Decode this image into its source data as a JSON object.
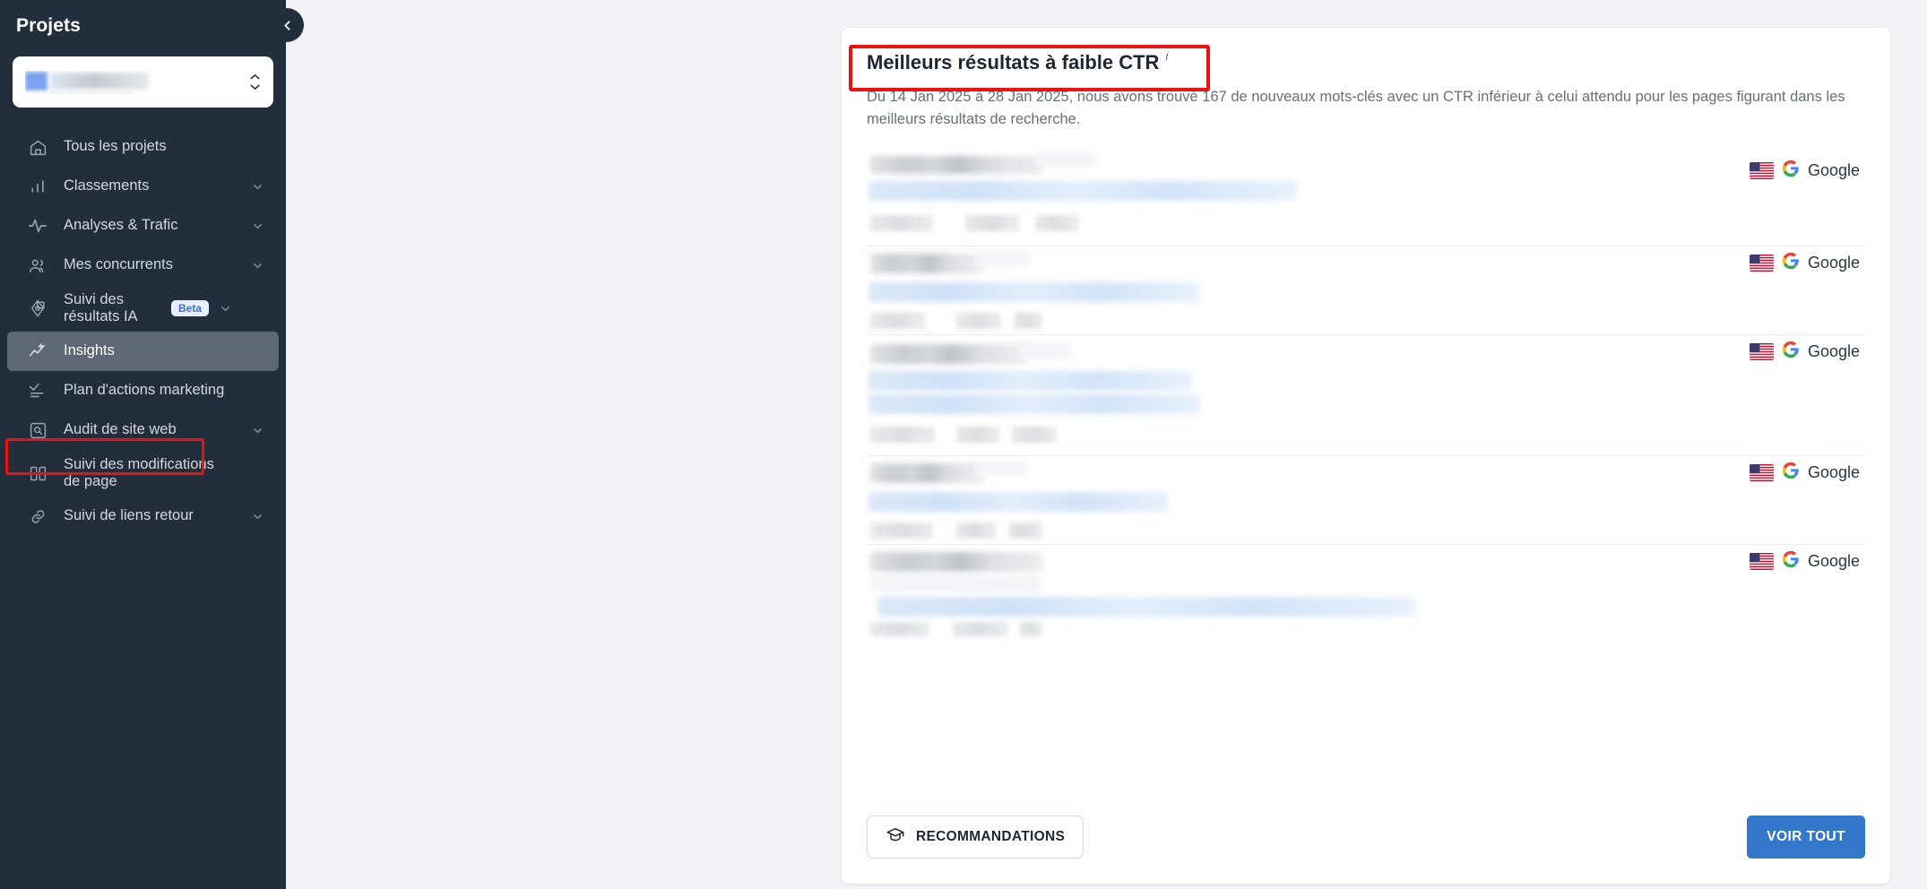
{
  "sidebar": {
    "title": "Projets",
    "collapse_icon": "chevron-left-icon",
    "project_selector": {
      "value": "",
      "stepper_icon": "chevron-up-down-icon"
    },
    "items": [
      {
        "label": "Tous les projets",
        "icon": "home-icon",
        "chevron": false,
        "badge": null,
        "active": false
      },
      {
        "label": "Classements",
        "icon": "bar-chart-icon",
        "chevron": true,
        "badge": null,
        "active": false
      },
      {
        "label": "Analyses & Trafic",
        "icon": "activity-icon",
        "chevron": true,
        "badge": null,
        "active": false
      },
      {
        "label": "Mes concurrents",
        "icon": "users-icon",
        "chevron": true,
        "badge": null,
        "active": false
      },
      {
        "label": "Suivi des résultats IA",
        "icon": "ai-node-icon",
        "chevron": true,
        "badge": "Beta",
        "active": false
      },
      {
        "label": "Insights",
        "icon": "insights-icon",
        "chevron": false,
        "badge": null,
        "active": true
      },
      {
        "label": "Plan d'actions marketing",
        "icon": "checklist-icon",
        "chevron": false,
        "badge": null,
        "active": false
      },
      {
        "label": "Audit de site web",
        "icon": "magnifier-box-icon",
        "chevron": true,
        "badge": null,
        "active": false
      },
      {
        "label": "Suivi des modifications de page",
        "icon": "page-compare-icon",
        "chevron": false,
        "badge": null,
        "active": false
      },
      {
        "label": "Suivi de liens retour",
        "icon": "link-icon",
        "chevron": true,
        "badge": null,
        "active": false
      }
    ]
  },
  "card": {
    "title": "Meilleurs résultats à faible CTR",
    "info_icon": "i",
    "description": "Du 14 Jan 2025 à 28 Jan 2025, nous avons trouvé 167 de nouveaux mots-clés avec un CTR inférieur à celui attendu pour les pages figurant dans les meilleurs résultats de recherche.",
    "rows": [
      {
        "engine": "Google",
        "flag": "us-flag-icon"
      },
      {
        "engine": "Google",
        "flag": "us-flag-icon"
      },
      {
        "engine": "Google",
        "flag": "us-flag-icon"
      },
      {
        "engine": "Google",
        "flag": "us-flag-icon"
      },
      {
        "engine": "Google",
        "flag": "us-flag-icon"
      }
    ],
    "footer": {
      "recommendations_label": "RECOMMANDATIONS",
      "recommendations_icon": "graduation-cap-icon",
      "see_all_label": "VOIR TOUT"
    }
  },
  "colors": {
    "sidebar_bg": "#232e3c",
    "accent_blue": "#3478cc",
    "highlight_red": "#ef1111",
    "beta_badge_text": "#3f72d8",
    "page_bg": "#f1f3f6"
  }
}
